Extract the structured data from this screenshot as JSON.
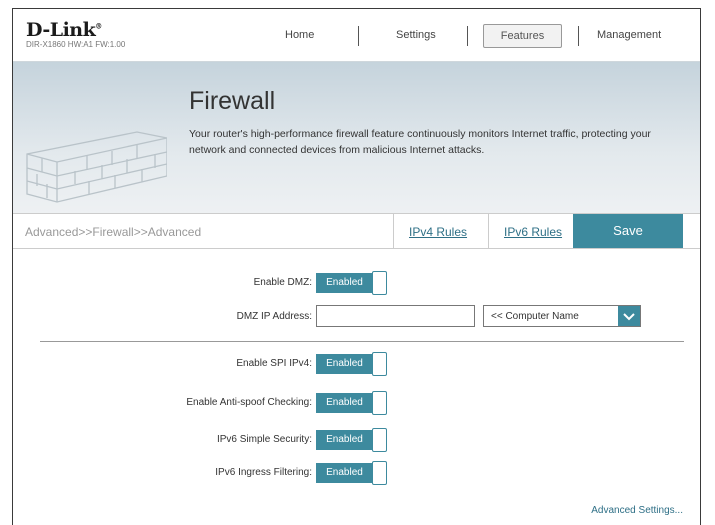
{
  "brand": {
    "logo": "D-Link",
    "model_info": "DIR-X1860 HW:A1 FW:1.00"
  },
  "nav": {
    "home": "Home",
    "settings": "Settings",
    "features": "Features",
    "management": "Management"
  },
  "banner": {
    "title": "Firewall",
    "description": "Your router's high-performance firewall feature continuously monitors Internet traffic, protecting your network and connected devices from malicious Internet attacks."
  },
  "breadcrumb": "Advanced>>Firewall>>Advanced",
  "tabs": {
    "ipv4": "IPv4 Rules",
    "ipv6": "IPv6 Rules"
  },
  "save_label": "Save",
  "dmz": {
    "enable_label": "Enable DMZ:",
    "enable_value": "Enabled",
    "ip_label": "DMZ IP Address:",
    "ip_value": "",
    "computer_select": "<< Computer Name"
  },
  "security": {
    "spi_label": "Enable SPI IPv4:",
    "spi_value": "Enabled",
    "antispoof_label": "Enable Anti-spoof Checking:",
    "antispoof_value": "Enabled",
    "ipv6_simple_label": "IPv6 Simple Security:",
    "ipv6_simple_value": "Enabled",
    "ipv6_ingress_label": "IPv6 Ingress Filtering:",
    "ipv6_ingress_value": "Enabled"
  },
  "advanced_link": "Advanced Settings...",
  "colors": {
    "accent": "#3d8a9e",
    "link": "#2e6f86"
  }
}
